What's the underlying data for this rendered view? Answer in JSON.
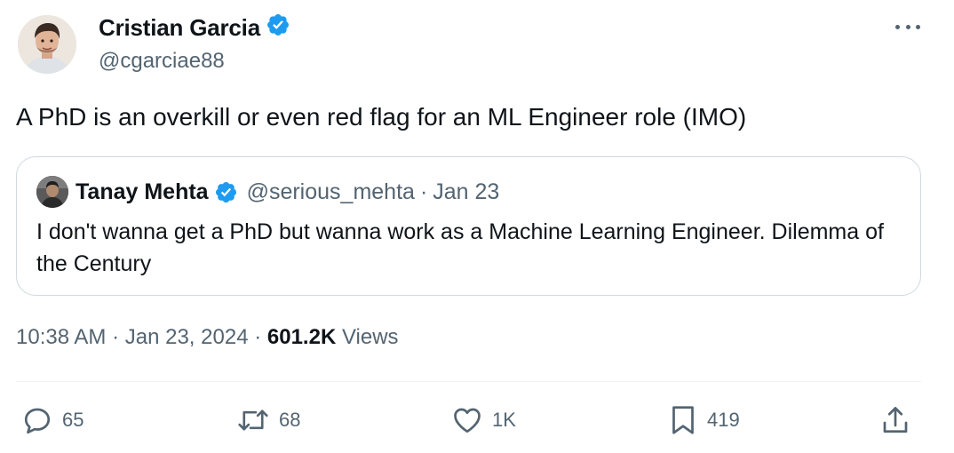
{
  "author": {
    "name": "Cristian Garcia",
    "handle": "@cgarciae88",
    "verified": true
  },
  "tweet": {
    "text": "A PhD is an overkill or even red flag for an ML Engineer role (IMO)"
  },
  "quote": {
    "name": "Tanay Mehta",
    "handle": "@serious_mehta",
    "separator": "·",
    "date": "Jan 23",
    "text": "I don't wanna get a PhD but wanna work as a Machine Learning Engineer. Dilemma of the Century"
  },
  "meta": {
    "time": "10:38 AM",
    "separator": "·",
    "date": "Jan 23, 2024",
    "views_count": "601.2K",
    "views_label": "Views"
  },
  "actions": {
    "replies": "65",
    "retweets": "68",
    "likes": "1K",
    "bookmarks": "419"
  },
  "icons": {
    "more": "more-dots-icon",
    "verified": "verified-badge-icon",
    "reply": "reply-icon",
    "retweet": "retweet-icon",
    "like": "heart-icon",
    "bookmark": "bookmark-icon",
    "share": "share-icon"
  },
  "colors": {
    "verified": "#1d9bf0",
    "secondary_text": "#536471",
    "primary_text": "#0f1419",
    "border": "#cfd9de"
  }
}
